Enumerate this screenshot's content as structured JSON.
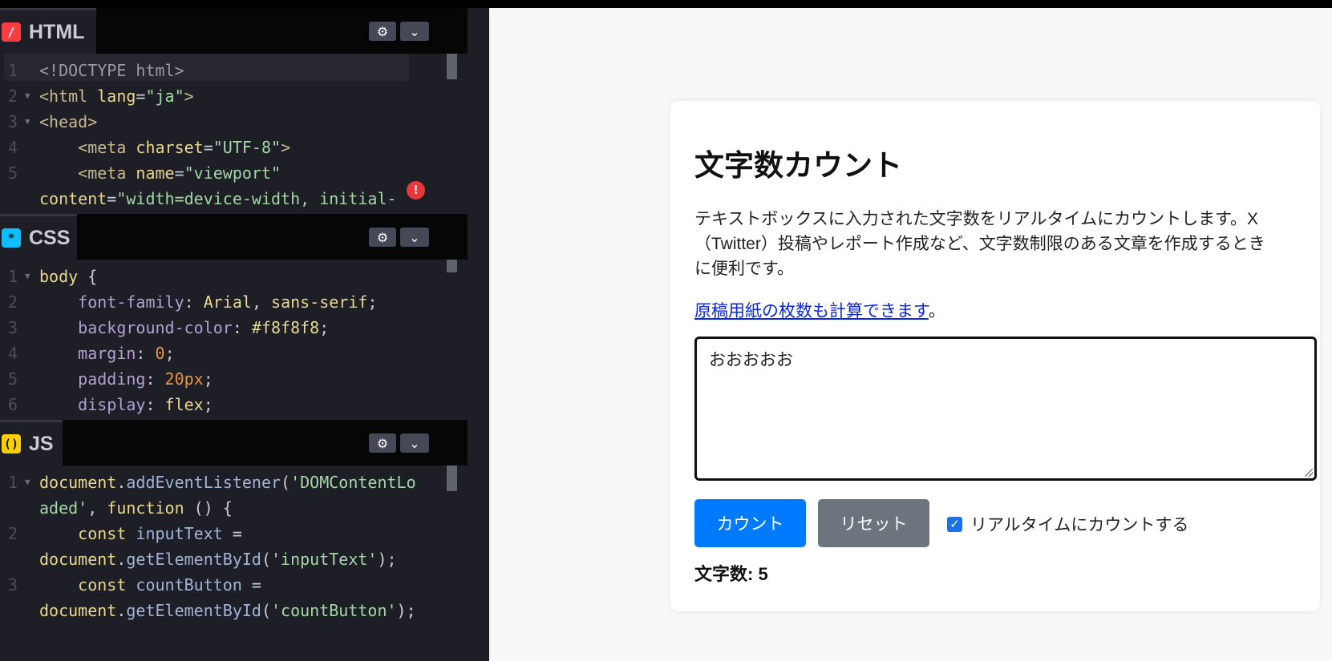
{
  "editor": {
    "html": {
      "label": "HTML",
      "icon": "slash-icon",
      "icon_color": "#ff3c41",
      "lines": [
        {
          "n": "1",
          "fold": false,
          "parts": [
            [
              "c-doctype",
              "<!DOCTYPE html>"
            ]
          ]
        },
        {
          "n": "2",
          "fold": true,
          "parts": [
            [
              "c-tag",
              "<html "
            ],
            [
              "c-attr",
              "lang"
            ],
            [
              "c-plain",
              "="
            ],
            [
              "c-str",
              "\"ja\""
            ],
            [
              "c-tag",
              ">"
            ]
          ]
        },
        {
          "n": "3",
          "fold": true,
          "parts": [
            [
              "c-tag",
              "<head>"
            ]
          ]
        },
        {
          "n": "4",
          "fold": false,
          "parts": [
            [
              "c-tag",
              "    <meta "
            ],
            [
              "c-attr",
              "charset"
            ],
            [
              "c-plain",
              "="
            ],
            [
              "c-str",
              "\"UTF-8\""
            ],
            [
              "c-tag",
              ">"
            ]
          ]
        },
        {
          "n": "5",
          "fold": false,
          "parts": [
            [
              "c-tag",
              "    <meta "
            ],
            [
              "c-attr",
              "name"
            ],
            [
              "c-plain",
              "="
            ],
            [
              "c-str",
              "\"viewport\""
            ]
          ]
        },
        {
          "n": "",
          "fold": false,
          "parts": [
            [
              "c-attr",
              "content"
            ],
            [
              "c-plain",
              "="
            ],
            [
              "c-str",
              "\"width=device-width, initial-"
            ]
          ]
        }
      ]
    },
    "css": {
      "label": "CSS",
      "icon": "asterisk-icon",
      "icon_color": "#0ebeff",
      "lines": [
        {
          "n": "1",
          "fold": true,
          "parts": [
            [
              "c-sel",
              "body "
            ],
            [
              "c-plain",
              "{"
            ]
          ]
        },
        {
          "n": "2",
          "fold": false,
          "parts": [
            [
              "c-prop",
              "    font-family"
            ],
            [
              "c-plain",
              ": "
            ],
            [
              "c-attr",
              "Arial"
            ],
            [
              "c-plain",
              ", "
            ],
            [
              "c-attr",
              "sans-serif"
            ],
            [
              "c-plain",
              ";"
            ]
          ]
        },
        {
          "n": "3",
          "fold": false,
          "parts": [
            [
              "c-prop",
              "    background-color"
            ],
            [
              "c-plain",
              ": "
            ],
            [
              "c-attr",
              "#f8f8f8"
            ],
            [
              "c-plain",
              ";"
            ]
          ]
        },
        {
          "n": "4",
          "fold": false,
          "parts": [
            [
              "c-prop",
              "    margin"
            ],
            [
              "c-plain",
              ": "
            ],
            [
              "c-num",
              "0"
            ],
            [
              "c-plain",
              ";"
            ]
          ]
        },
        {
          "n": "5",
          "fold": false,
          "parts": [
            [
              "c-prop",
              "    padding"
            ],
            [
              "c-plain",
              ": "
            ],
            [
              "c-num",
              "20px"
            ],
            [
              "c-plain",
              ";"
            ]
          ]
        },
        {
          "n": "6",
          "fold": false,
          "parts": [
            [
              "c-prop",
              "    display"
            ],
            [
              "c-plain",
              ": "
            ],
            [
              "c-attr",
              "flex"
            ],
            [
              "c-plain",
              ";"
            ]
          ]
        }
      ]
    },
    "js": {
      "label": "JS",
      "icon": "parentheses-icon",
      "icon_color": "#fcd000",
      "lines": [
        {
          "n": "1",
          "fold": true,
          "parts": [
            [
              "c-attr",
              "document"
            ],
            [
              "c-plain",
              "."
            ],
            [
              "c-var",
              "addEventListener"
            ],
            [
              "c-plain",
              "("
            ],
            [
              "c-str",
              "'DOMContentLo"
            ]
          ]
        },
        {
          "n": "",
          "fold": false,
          "parts": [
            [
              "c-str",
              "aded'"
            ],
            [
              "c-plain",
              ", "
            ],
            [
              "c-attr",
              "function"
            ],
            [
              "c-plain",
              " () {"
            ]
          ]
        },
        {
          "n": "2",
          "fold": false,
          "parts": [
            [
              "c-attr",
              "    const "
            ],
            [
              "c-var",
              "inputText"
            ],
            [
              "c-plain",
              " ="
            ]
          ]
        },
        {
          "n": "",
          "fold": false,
          "parts": [
            [
              "c-attr",
              "document"
            ],
            [
              "c-plain",
              "."
            ],
            [
              "c-var",
              "getElementById"
            ],
            [
              "c-plain",
              "("
            ],
            [
              "c-str",
              "'inputText'"
            ],
            [
              "c-plain",
              ");"
            ]
          ]
        },
        {
          "n": "3",
          "fold": false,
          "parts": [
            [
              "c-attr",
              "    const "
            ],
            [
              "c-var",
              "countButton"
            ],
            [
              "c-plain",
              " ="
            ]
          ]
        },
        {
          "n": "",
          "fold": false,
          "parts": [
            [
              "c-attr",
              "document"
            ],
            [
              "c-plain",
              "."
            ],
            [
              "c-var",
              "getElementById"
            ],
            [
              "c-plain",
              "("
            ],
            [
              "c-str",
              "'countButton'"
            ],
            [
              "c-plain",
              ");"
            ]
          ]
        }
      ]
    }
  },
  "preview": {
    "title": "文字数カウント",
    "description": "テキストボックスに入力された文字数をリアルタイムにカウントします。X（Twitter）投稿やレポート作成など、文字数制限のある文章を作成するときに便利です。",
    "link_text": "原稿用紙の枚数も計算できます",
    "link_suffix": "。",
    "textarea_value": "おおおおお",
    "count_button": "カウント",
    "reset_button": "リセット",
    "realtime_label": "リアルタイムにカウントする",
    "realtime_checked": true,
    "result": "文字数: 5"
  }
}
